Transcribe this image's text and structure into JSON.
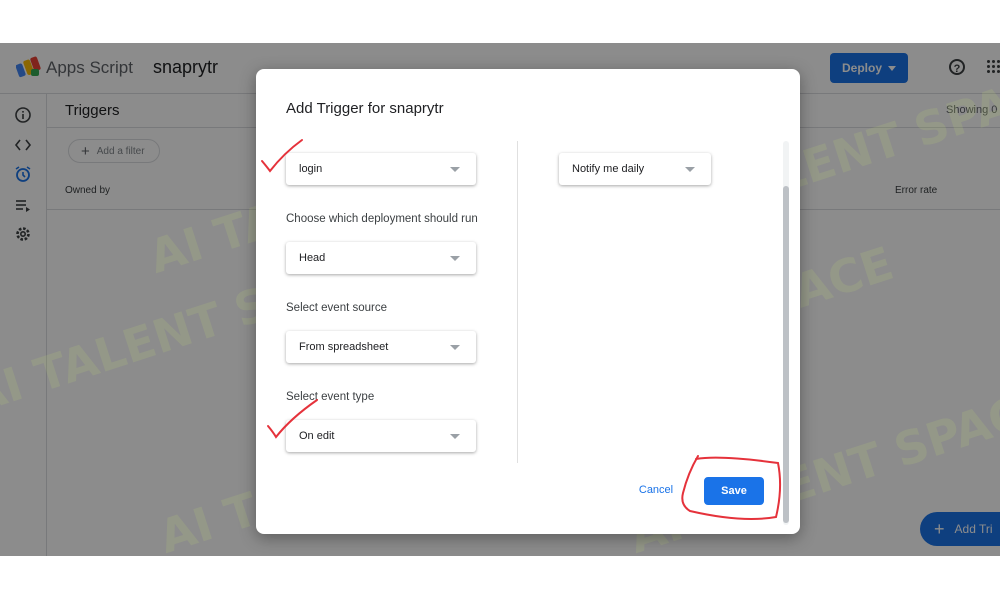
{
  "app": {
    "name": "Apps Script",
    "project": "snaprytr",
    "deploy_label": "Deploy",
    "help_glyph": "?"
  },
  "rail": {
    "icons": [
      "info-icon",
      "code-icon",
      "alarm-clock-icon",
      "executions-icon",
      "gear-icon"
    ]
  },
  "triggers_page": {
    "title": "Triggers",
    "showing_text": "Showing 0",
    "filter_label": "Add a filter",
    "columns": [
      "Owned by",
      "Error rate"
    ],
    "fab_label": "Add Tri"
  },
  "dialog": {
    "title": "Add Trigger for snaprytr",
    "function_select": "login",
    "deployment_label": "Choose which deployment should run",
    "deployment_select": "Head",
    "event_source_label": "Select event source",
    "event_source_select": "From spreadsheet",
    "event_type_label": "Select event type",
    "event_type_select": "On edit",
    "notify_select": "Notify me daily",
    "cancel_label": "Cancel",
    "save_label": "Save"
  },
  "watermark": {
    "text": "AI TALENT SPACE"
  },
  "colors": {
    "accent": "#1a73e8",
    "annotation": "#e5323b",
    "watermark": "#bedc78"
  }
}
